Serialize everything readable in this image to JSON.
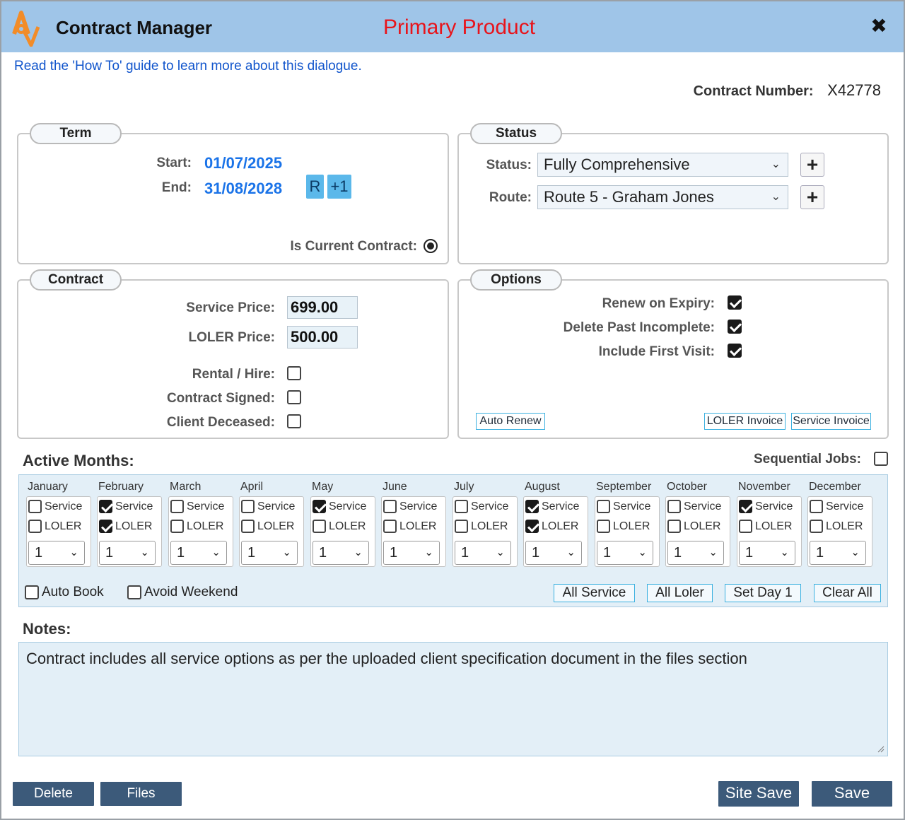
{
  "window": {
    "app_title": "Contract Manager",
    "mode_title": "Primary Product",
    "close_label": "✖"
  },
  "howto_link": "Read the 'How To' guide to learn more about this dialogue.",
  "contract_number": {
    "label": "Contract Number:",
    "value": "X42778"
  },
  "term": {
    "legend": "Term",
    "start_label": "Start:",
    "start_value": "01/07/2025",
    "end_label": "End:",
    "end_value": "31/08/2028",
    "r_button": "R",
    "plus1_button": "+1",
    "is_current_label": "Is Current Contract:",
    "is_current": true
  },
  "status": {
    "legend": "Status",
    "status_label": "Status:",
    "status_value": "Fully Comprehensive",
    "route_label": "Route:",
    "route_value": "Route 5 - Graham Jones",
    "add_label": "+"
  },
  "contract": {
    "legend": "Contract",
    "service_price_label": "Service Price:",
    "service_price": "699.00",
    "loler_price_label": "LOLER Price:",
    "loler_price": "500.00",
    "rental_label": "Rental / Hire:",
    "rental": false,
    "signed_label": "Contract Signed:",
    "signed": false,
    "deceased_label": "Client Deceased:",
    "deceased": false
  },
  "options": {
    "legend": "Options",
    "renew_label": "Renew on Expiry:",
    "renew": true,
    "delete_past_label": "Delete Past Incomplete:",
    "delete_past": true,
    "first_visit_label": "Include First Visit:",
    "first_visit": true,
    "auto_renew_button": "Auto Renew",
    "loler_invoice_button": "LOLER Invoice",
    "service_invoice_button": "Service Invoice"
  },
  "active_months": {
    "heading": "Active Months:",
    "sequential_label": "Sequential Jobs:",
    "sequential": false,
    "service_label": "Service",
    "loler_label": "LOLER",
    "months": [
      {
        "name": "January",
        "service": false,
        "loler": false,
        "day": "1"
      },
      {
        "name": "February",
        "service": true,
        "loler": true,
        "day": "1"
      },
      {
        "name": "March",
        "service": false,
        "loler": false,
        "day": "1"
      },
      {
        "name": "April",
        "service": false,
        "loler": false,
        "day": "1"
      },
      {
        "name": "May",
        "service": true,
        "loler": false,
        "day": "1"
      },
      {
        "name": "June",
        "service": false,
        "loler": false,
        "day": "1"
      },
      {
        "name": "July",
        "service": false,
        "loler": false,
        "day": "1"
      },
      {
        "name": "August",
        "service": true,
        "loler": true,
        "day": "1"
      },
      {
        "name": "September",
        "service": false,
        "loler": false,
        "day": "1"
      },
      {
        "name": "October",
        "service": false,
        "loler": false,
        "day": "1"
      },
      {
        "name": "November",
        "service": true,
        "loler": false,
        "day": "1"
      },
      {
        "name": "December",
        "service": false,
        "loler": false,
        "day": "1"
      }
    ],
    "auto_book_label": "Auto Book",
    "auto_book": false,
    "avoid_weekend_label": "Avoid Weekend",
    "avoid_weekend": false,
    "all_service_button": "All Service",
    "all_loler_button": "All Loler",
    "set_day_button": "Set Day 1",
    "clear_all_button": "Clear All"
  },
  "notes": {
    "heading": "Notes:",
    "text": "Contract includes all service options as per the uploaded client specification document in the files section"
  },
  "footer": {
    "delete_button": "Delete",
    "files_button": "Files",
    "site_save_button": "Site Save",
    "save_button": "Save"
  },
  "colors": {
    "titlebar": "#9fc5e8",
    "mode_title": "#e8141b",
    "link": "#1155cc",
    "date": "#1a73e8",
    "dark_button": "#3c5a7a",
    "accent_border": "#3ab0e0"
  }
}
